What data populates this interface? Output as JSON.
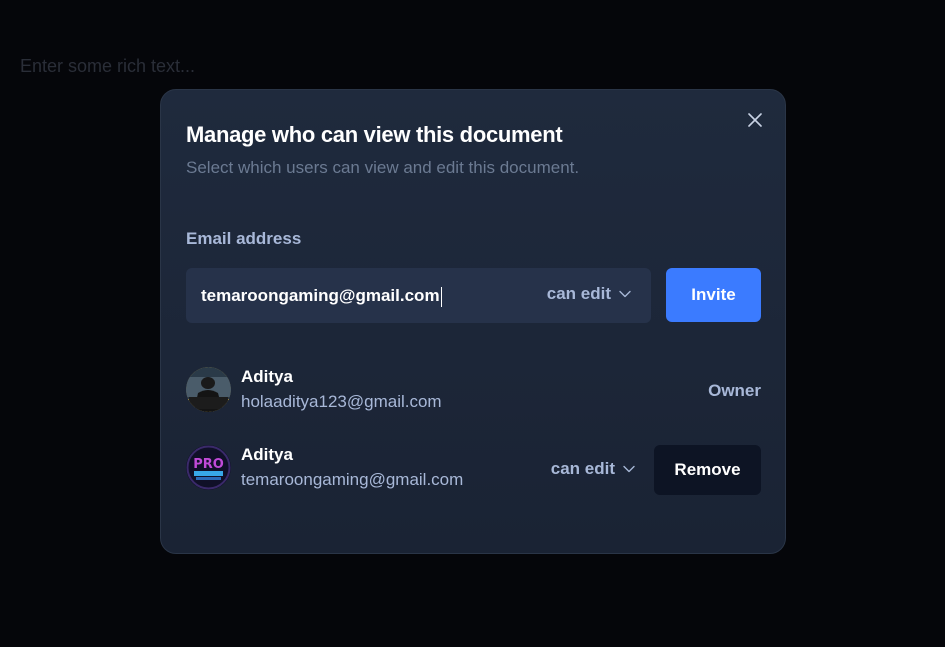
{
  "editor": {
    "placeholder": "Enter some rich text..."
  },
  "dialog": {
    "title": "Manage who can view this document",
    "subtitle": "Select which users can view and edit this document.",
    "close_icon": "close-icon"
  },
  "invite": {
    "label": "Email address",
    "email_value": "temaroongaming@gmail.com",
    "permission": "can edit",
    "permission_icon": "chevron-down-icon",
    "button_label": "Invite"
  },
  "users": [
    {
      "name": "Aditya",
      "email": "holaaditya123@gmail.com",
      "role": "Owner",
      "avatar_icon": "avatar-photo"
    },
    {
      "name": "Aditya",
      "email": "temaroongaming@gmail.com",
      "permission": "can edit",
      "remove_label": "Remove",
      "avatar_icon": "avatar-pro-gamer"
    }
  ],
  "colors": {
    "background": "#05060a",
    "dialog": "#1f2a3d",
    "accent": "#3b7bff",
    "muted_text": "#a8b8d8"
  }
}
